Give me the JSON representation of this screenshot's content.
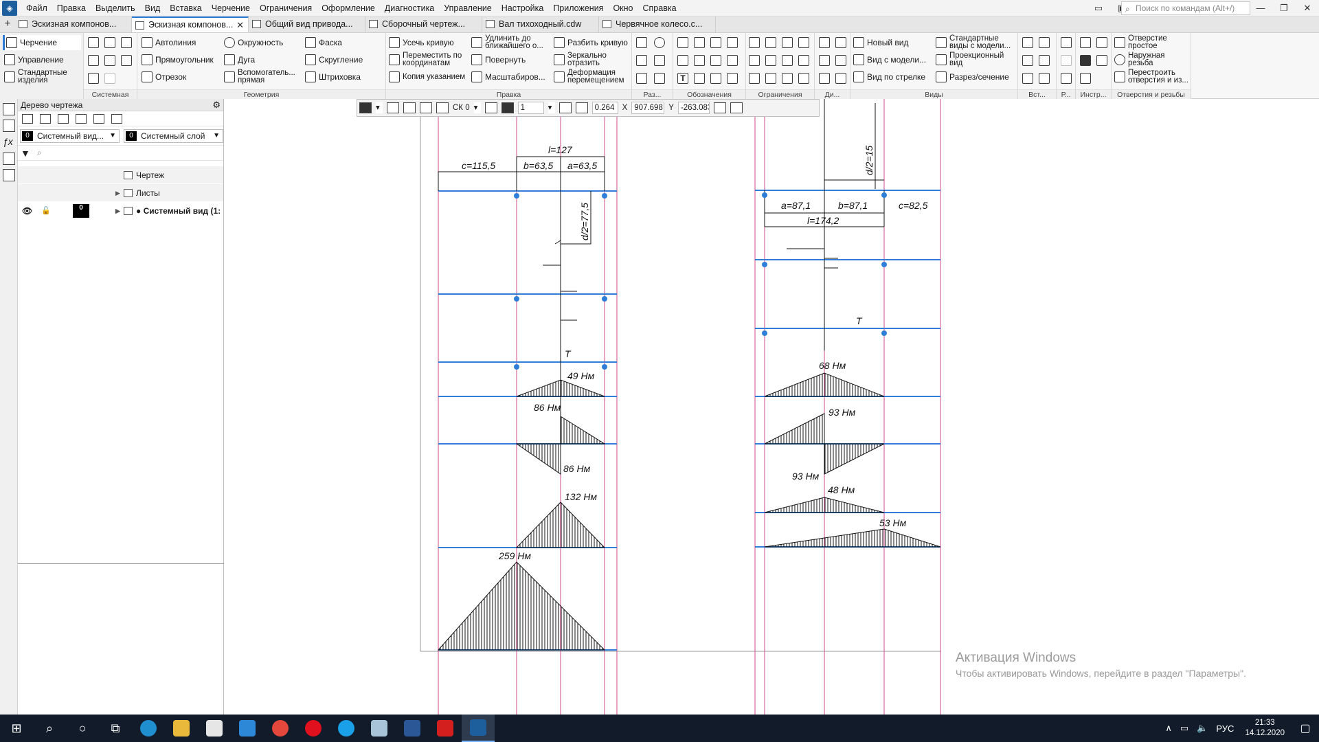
{
  "menubar": {
    "items": [
      "Файл",
      "Правка",
      "Выделить",
      "Вид",
      "Вставка",
      "Черчение",
      "Ограничения",
      "Оформление",
      "Диагностика",
      "Управление",
      "Настройка",
      "Приложения",
      "Окно",
      "Справка"
    ],
    "search_placeholder": "Поиск по командам (Alt+/)"
  },
  "doc_tabs": [
    {
      "label": "Эскизная компонов..."
    },
    {
      "label": "Эскизная компонов...",
      "active": true
    },
    {
      "label": "Общий вид привода..."
    },
    {
      "label": "Сборочный чертеж..."
    },
    {
      "label": "Вал тихоходный.cdw"
    },
    {
      "label": "Червячное колесо.с..."
    }
  ],
  "ribbon": {
    "left_tabs": [
      "Черчение",
      "Управление",
      "Стандартные изделия"
    ],
    "groups": {
      "system": "Системная",
      "geometry": "Геометрия",
      "edit": "Правка",
      "dims": "Раз...",
      "notation": "Обозначения",
      "constraints": "Ограничения",
      "di": "Ди...",
      "views": "Виды",
      "insert": "Вст...",
      "r": "Р...",
      "tools": "Инстр...",
      "holes": "Отверстия и резьбы"
    },
    "geometry_buttons": [
      "Автолиния",
      "Окружность",
      "Фаска",
      "Прямоугольник",
      "Дуга",
      "Скругление",
      "Отрезок",
      "Вспомогатель... прямая",
      "Штриховка"
    ],
    "edit_buttons": [
      "Усечь кривую",
      "Удлинить до ближайшего о...",
      "Разбить кривую",
      "Переместить по координатам",
      "Повернуть",
      "Зеркально отразить",
      "Копия указанием",
      "Масштабиров...",
      "Деформация перемещением"
    ],
    "views_buttons": [
      "Новый вид",
      "Стандартные виды с модели...",
      "Вид с модели...",
      "Проекционный вид",
      "Вид по стрелке",
      "Разрез/сечение"
    ],
    "holes_buttons": [
      "Отверстие простое",
      "Наружная резьба",
      "Перестроить отверстия и из..."
    ]
  },
  "tree": {
    "title": "Дерево чертежа",
    "view_select": "Системный вид...",
    "view_num": "0",
    "layer_select": "Системный слой",
    "layer_num": "0",
    "rows": [
      "Чертеж",
      "Листы",
      "● Системный вид (1:"
    ],
    "sys_num": "0"
  },
  "floatbar": {
    "cs": "СК 0",
    "step": "1",
    "zoom": "0.264",
    "x_label": "X",
    "x_value": "907.698",
    "y_label": "Y",
    "y_value": "-263.083"
  },
  "drawing_left": {
    "dims": [
      "l=127",
      "c=115,5",
      "b=63,5",
      "a=63,5",
      "d/2=77,5"
    ],
    "moments": [
      "49 Нм",
      "86 Нм",
      "86 Нм",
      "132 Нм",
      "259 Нм"
    ],
    "torque": "T"
  },
  "drawing_right": {
    "dims": [
      "d/2=15",
      "a=87,1",
      "b=87,1",
      "c=82,5",
      "l=174,2"
    ],
    "moments": [
      "68 Нм",
      "93 Нм",
      "93 Нм",
      "48 Нм",
      "53 Нм"
    ],
    "torque": "T"
  },
  "watermark": {
    "title": "Активация Windows",
    "subtitle": "Чтобы активировать Windows, перейдите в раздел \"Параметры\"."
  },
  "taskbar": {
    "lang": "РУС",
    "time": "21:33",
    "date": "14.12.2020"
  },
  "colors": {
    "blue_line": "#2f7fd8",
    "pink_line": "#d04a8a",
    "accent": "#2b7bd4"
  }
}
